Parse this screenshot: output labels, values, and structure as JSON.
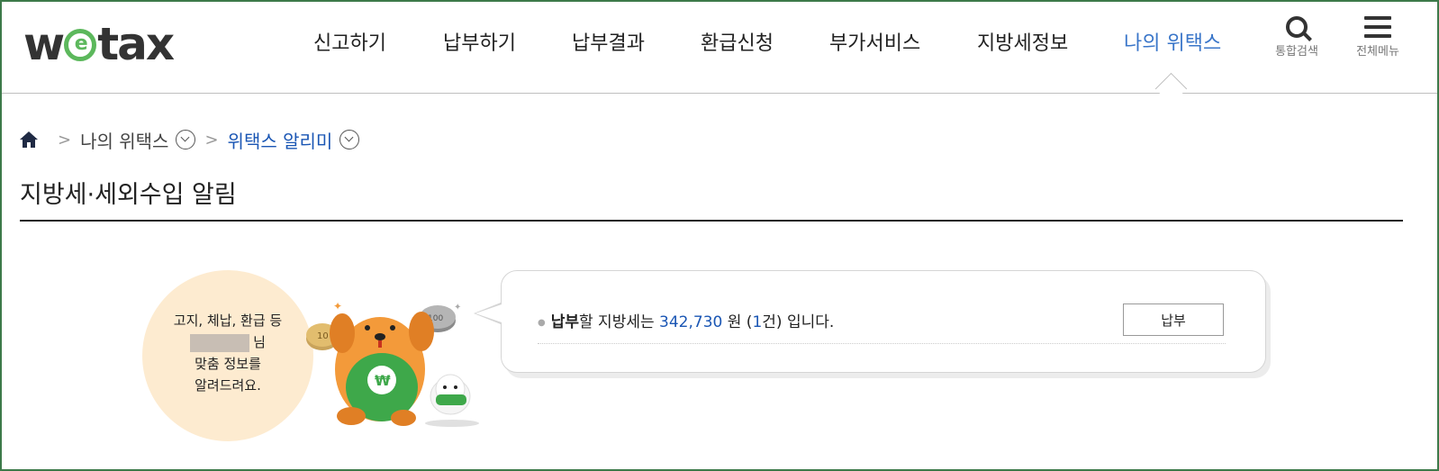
{
  "logo": {
    "text_w": "w",
    "text_e": "e",
    "text_tax": "tax"
  },
  "nav": {
    "items": [
      {
        "label": "신고하기"
      },
      {
        "label": "납부하기"
      },
      {
        "label": "납부결과"
      },
      {
        "label": "환급신청"
      },
      {
        "label": "부가서비스"
      },
      {
        "label": "지방세정보"
      },
      {
        "label": "나의 위택스",
        "active": true
      }
    ],
    "search_label": "통합검색",
    "menu_label": "전체메뉴"
  },
  "breadcrumb": {
    "home_icon": "home-icon",
    "level1": "나의 위택스",
    "level2": "위택스 알리미"
  },
  "page": {
    "title": "지방세·세외수입 알림"
  },
  "greeting": {
    "line1": "고지, 체납, 환급 등",
    "name_suffix": "님",
    "line3": "맞춤 정보를",
    "line4": "알려드려요."
  },
  "notice": {
    "bold": "납부",
    "text1": "할 지방세는 ",
    "amount": "342,730",
    "text2": " 원 (",
    "count": "1",
    "text3": "건) 입니다.",
    "button": "납부"
  },
  "colors": {
    "accent": "#3a76c9",
    "link": "#1a56b4",
    "brand_green": "#5cb85c",
    "greeting_bg": "#fdebd0"
  }
}
